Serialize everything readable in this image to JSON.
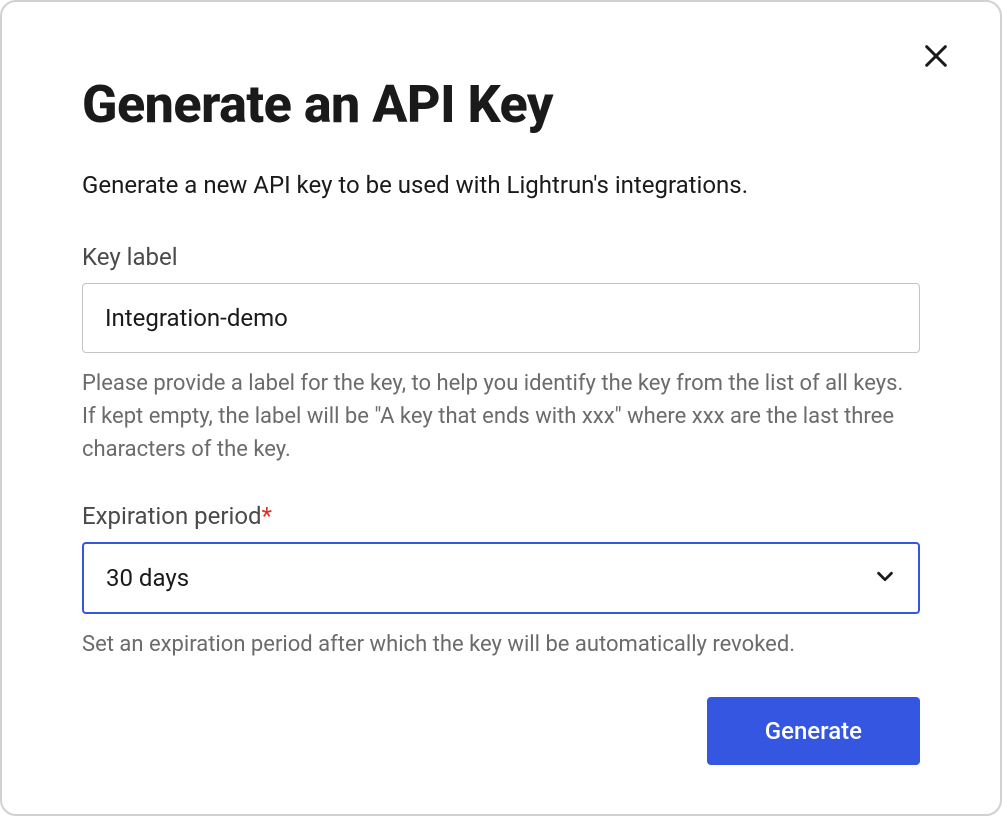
{
  "modal": {
    "title": "Generate an API Key",
    "description": "Generate a new API key to be used with Lightrun's integrations.",
    "fields": {
      "keyLabel": {
        "label": "Key label",
        "value": "Integration-demo",
        "helpText": "Please provide a label for the key, to help you identify the key from the list of all keys. If kept empty, the label will be \"A key that ends with xxx\" where xxx are the last three characters of the key."
      },
      "expiration": {
        "label": "Expiration period",
        "required": true,
        "value": "30 days",
        "helpText": "Set an expiration period after which the key will be automatically revoked."
      }
    },
    "buttons": {
      "generate": "Generate"
    }
  }
}
